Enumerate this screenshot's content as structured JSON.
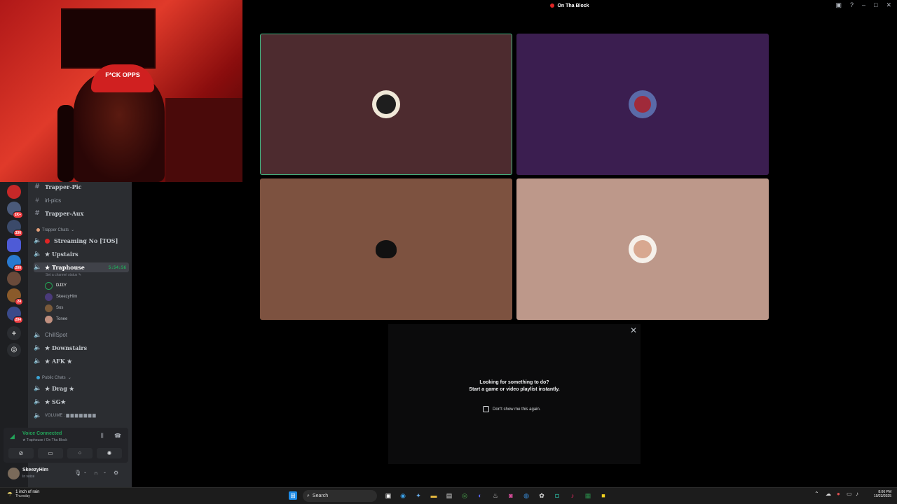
{
  "window": {
    "title": "On Tha Block"
  },
  "webcam": {
    "hat_text": "F*CK OPPS"
  },
  "channels": {
    "text": [
      {
        "name": "Trapper-Pic"
      },
      {
        "name": "irl-pics"
      },
      {
        "name": "Trapper-Aux"
      }
    ],
    "category_trapper": "Trapper Chats",
    "voice": [
      {
        "name": "Streaming No  [TOS]"
      },
      {
        "name": "★ Upstairs"
      },
      {
        "name": "★ Traphouse",
        "timer": "5:54:56",
        "status_hint": "Set a channel status"
      },
      {
        "name": "ChillSpot"
      },
      {
        "name": "★ Downstairs"
      },
      {
        "name": "★ AFK ★"
      }
    ],
    "members": [
      {
        "name": "DJΣY"
      },
      {
        "name": "SkeezyHim"
      },
      {
        "name": "Sos"
      },
      {
        "name": "Tonee"
      }
    ],
    "category_public": "Public Chats",
    "public_voice": [
      {
        "name": "★ Drag ★"
      },
      {
        "name": "★ SG★"
      },
      {
        "name": "VOLUME : ▆ ▆ ▆ ▆ ▆ ▆ ▆"
      }
    ]
  },
  "servers": {
    "badges": [
      "1K+",
      "336",
      "200",
      "24",
      "204"
    ]
  },
  "voice_panel": {
    "status": "Voice Connected",
    "location": "★ Traphouse / On Tha Block"
  },
  "user_panel": {
    "username": "SkeezyHim",
    "status": "In voice"
  },
  "activity_prompt": {
    "line1": "Looking for something to do?",
    "line2": "Start a game or video playlist instantly.",
    "checkbox_label": "Don't show me this again."
  },
  "taskbar": {
    "weather_line1": "1 inch of rain",
    "weather_line2": "Thursday",
    "search_placeholder": "Search",
    "time": "8:06 PM",
    "date": "10/23/2025"
  },
  "colors": {
    "speaking_border": "#43b581",
    "voice_connected": "#23a55a",
    "badge": "#f23f43"
  }
}
